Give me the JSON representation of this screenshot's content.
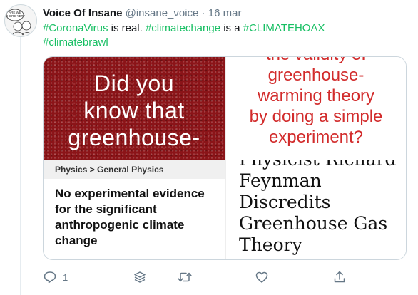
{
  "tweet": {
    "author_name": "Voice Of Insane",
    "handle": "@insane_voice",
    "separator": "·",
    "date": "16 mar",
    "text_parts": [
      "#CoronaVirus",
      " is real. ",
      "#climatechange",
      " is a ",
      "#CLIMATEHOAX",
      "#climatebrawl"
    ]
  },
  "avatar": {
    "text_line1": "ARE WE",
    "text_line2": "THERE YET?"
  },
  "card": {
    "left_image_text": [
      "Did you",
      "know that",
      "greenhouse-"
    ],
    "breadcrumb": "Physics > General Physics",
    "article_title": "No experimental evidence for the significant anthropogenic climate change",
    "right_top_text": [
      "the validity of",
      "greenhouse-",
      "warming theory",
      "by doing a simple",
      "experiment?"
    ],
    "right_bottom_text": [
      "Physicist Richard",
      "Feynman",
      "Discredits",
      "Greenhouse Gas",
      "Theory"
    ]
  },
  "actions": {
    "reply_count": "1",
    "icons": [
      "reply-icon",
      "stack-icon",
      "retweet-icon",
      "like-icon",
      "share-icon"
    ]
  },
  "colors": {
    "hashtag": "#17bf63",
    "muted": "#657786",
    "image_red": "#8b1418",
    "text_red": "#d22c2c"
  }
}
